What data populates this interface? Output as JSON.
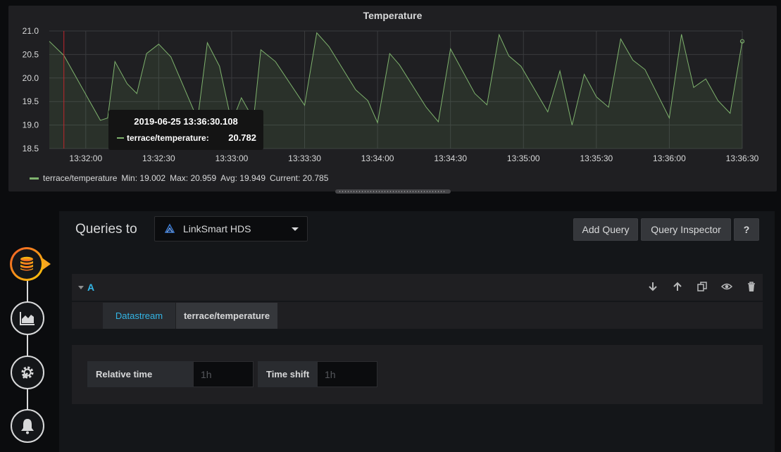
{
  "panel": {
    "title": "Temperature"
  },
  "chart_data": {
    "type": "line",
    "title": "Temperature",
    "ylim": [
      18.5,
      21.0
    ],
    "yticks": [
      "18.5",
      "19.0",
      "19.5",
      "20.0",
      "20.5",
      "21.0"
    ],
    "xticks": [
      "13:32:00",
      "13:32:30",
      "13:33:00",
      "13:33:30",
      "13:34:00",
      "13:34:30",
      "13:35:00",
      "13:35:30",
      "13:36:00",
      "13:36:30"
    ],
    "x_start": "13:31:45",
    "x_end": "13:36:30",
    "grid": true,
    "legend_placement": "bottom-left",
    "series": [
      {
        "name": "terrace/temperature",
        "color": "#7eb26d",
        "points": [
          [
            "13:31:45",
            20.78
          ],
          [
            "13:31:51",
            20.48
          ],
          [
            "13:32:06",
            19.1
          ],
          [
            "13:32:09",
            19.15
          ],
          [
            "13:32:12",
            20.35
          ],
          [
            "13:32:17",
            19.88
          ],
          [
            "13:32:21",
            19.67
          ],
          [
            "13:32:25",
            20.52
          ],
          [
            "13:32:30",
            20.72
          ],
          [
            "13:32:35",
            20.45
          ],
          [
            "13:32:46",
            19.12
          ],
          [
            "13:32:50",
            20.75
          ],
          [
            "13:32:55",
            20.25
          ],
          [
            "13:33:00",
            19.05
          ],
          [
            "13:33:04",
            19.58
          ],
          [
            "13:33:09",
            19.12
          ],
          [
            "13:33:12",
            20.6
          ],
          [
            "13:33:18",
            20.35
          ],
          [
            "13:33:30",
            19.42
          ],
          [
            "13:33:35",
            20.96
          ],
          [
            "13:33:40",
            20.67
          ],
          [
            "13:33:51",
            19.75
          ],
          [
            "13:33:56",
            19.52
          ],
          [
            "13:34:00",
            19.05
          ],
          [
            "13:34:05",
            20.52
          ],
          [
            "13:34:09",
            20.28
          ],
          [
            "13:34:20",
            19.38
          ],
          [
            "13:34:25",
            19.07
          ],
          [
            "13:34:30",
            20.62
          ],
          [
            "13:34:40",
            19.67
          ],
          [
            "13:34:45",
            19.43
          ],
          [
            "13:34:50",
            20.92
          ],
          [
            "13:34:54",
            20.47
          ],
          [
            "13:34:59",
            20.25
          ],
          [
            "13:35:10",
            19.28
          ],
          [
            "13:35:15",
            20.15
          ],
          [
            "13:35:20",
            19.0
          ],
          [
            "13:35:25",
            20.08
          ],
          [
            "13:35:30",
            19.6
          ],
          [
            "13:35:35",
            19.38
          ],
          [
            "13:35:40",
            20.83
          ],
          [
            "13:35:45",
            20.38
          ],
          [
            "13:35:50",
            20.18
          ],
          [
            "13:36:00",
            19.15
          ],
          [
            "13:36:05",
            20.93
          ],
          [
            "13:36:10",
            19.8
          ],
          [
            "13:36:15",
            19.98
          ],
          [
            "13:36:20",
            19.52
          ],
          [
            "13:36:25",
            19.25
          ],
          [
            "13:36:30",
            20.78
          ]
        ]
      }
    ],
    "crosshair_time": "13:31:51"
  },
  "legend": {
    "series_name": "terrace/temperature",
    "min": "Min: 19.002",
    "max": "Max: 20.959",
    "avg": "Avg: 19.949",
    "current": "Current: 20.785"
  },
  "tooltip": {
    "time": "2019-06-25 13:36:30.108",
    "series": "terrace/temperature:",
    "value": "20.782"
  },
  "editor": {
    "queries_to": "Queries to",
    "datasource": "LinkSmart HDS",
    "add_query": "Add Query",
    "query_inspector": "Query Inspector",
    "help": "?"
  },
  "query": {
    "ref_id": "A",
    "datastream_label": "Datastream",
    "datastream_value": "terrace/temperature"
  },
  "options": {
    "relative_time_label": "Relative time",
    "relative_time_placeholder": "1h",
    "time_shift_label": "Time shift",
    "time_shift_placeholder": "1h"
  },
  "sidebar": {
    "steps": [
      "queries",
      "visualization",
      "general",
      "alert"
    ]
  },
  "colors": {
    "series": "#7eb26d",
    "accent_blue": "#33b5e5",
    "crosshair": "#c0262d"
  }
}
